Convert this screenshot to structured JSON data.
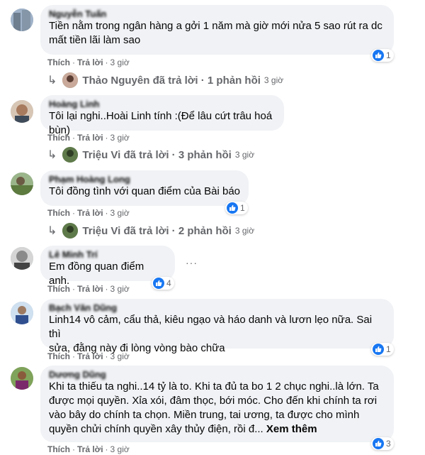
{
  "colors": {
    "bubble": "#f0f2f5",
    "like": "#1877f2",
    "meta": "#65676b"
  },
  "comments": [
    {
      "author": "Nguyễn Tuấn",
      "text": "Tiền nằm trong ngân hàng a gởi 1 năm mà giờ mới nửa 5 sao rút ra dc\nmất tiền lãi làm sao",
      "like": "Thích",
      "reply": "Trả lời",
      "time": "3 giờ",
      "reactions": "1",
      "replies": {
        "text": "Thảo Nguyên đã trả lời · 1 phản hồi",
        "time": "3 giờ"
      }
    },
    {
      "author": "Hoàng Linh",
      "text": "Tôi lại nghi..Hoài Linh tính :(Để lâu cứt trâu hoá bùn)",
      "like": "Thích",
      "reply": "Trả lời",
      "time": "3 giờ",
      "replies": {
        "text": "Triệu Vi đã trả lời · 3 phản hồi",
        "time": "3 giờ"
      }
    },
    {
      "author": "Phạm Hoàng Long",
      "text": "Tôi đồng tình với quan điểm của Bài báo",
      "like": "Thích",
      "reply": "Trả lời",
      "time": "3 giờ",
      "reactions": "1",
      "replies": {
        "text": "Triệu Vi đã trả lời · 2 phản hồi",
        "time": "3 giờ"
      }
    },
    {
      "author": "Lê Minh Trí",
      "text": "Em đồng quan điểm anh.",
      "like": "Thích",
      "reply": "Trả lời",
      "time": "3 giờ",
      "reactions": "4"
    },
    {
      "author": "Bạch Văn Dũng",
      "text": "Linh14 vô cảm, cẩu thả, kiêu ngạo và háo danh và lươn lẹo nữa. Sai thì\nsửa, đằng này đi lòng vòng bào chữa",
      "like": "Thích",
      "reply": "Trả lời",
      "time": "3 giờ",
      "reactions": "1"
    },
    {
      "author": "Dương Dũng",
      "text": "Khi ta thiếu ta nghi..14 tỷ là to. Khi ta đủ ta bo 1 2 chục nghi..là lớn. Ta\nđược mọi quyền. Xỉa xói, đâm thọc, bới móc. Cho đến khi chính ta rơi\nvào bây do chính ta chọn. Miền trung, tai ương, ta được cho mình\nquyền chửi chính quyền xây thủy điện, rồi đ...",
      "more": "Xem thêm",
      "like": "Thích",
      "reply": "Trả lời",
      "time": "3 giờ",
      "reactions": "3"
    }
  ]
}
